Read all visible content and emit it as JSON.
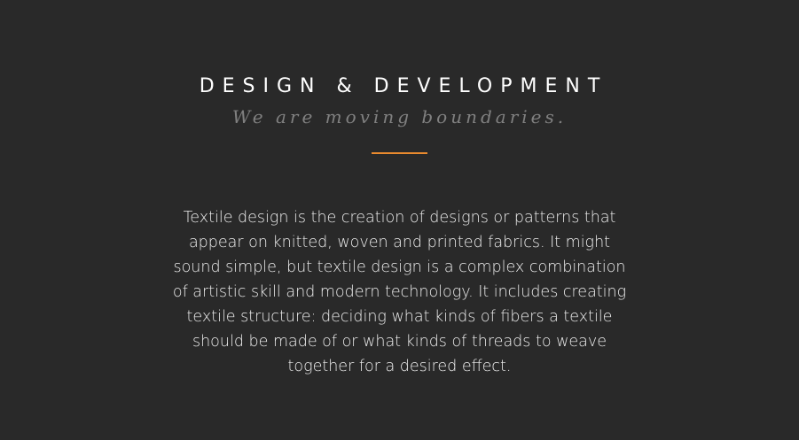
{
  "section": {
    "title": "DESIGN & DEVELOPMENT",
    "subtitle": "We are moving boundaries.",
    "accent_color": "#e98a2e",
    "body_lines": [
      "Textile design is the creation of designs or patterns that",
      "appear on knitted, woven and printed fabrics. It might",
      "sound simple, but textile design is a complex combination",
      "of artistic skill and modern technology. It includes creating",
      "textile structure: deciding what kinds of fibers a textile",
      "should be made of or what kinds of threads to weave",
      "together for a desired effect."
    ]
  }
}
